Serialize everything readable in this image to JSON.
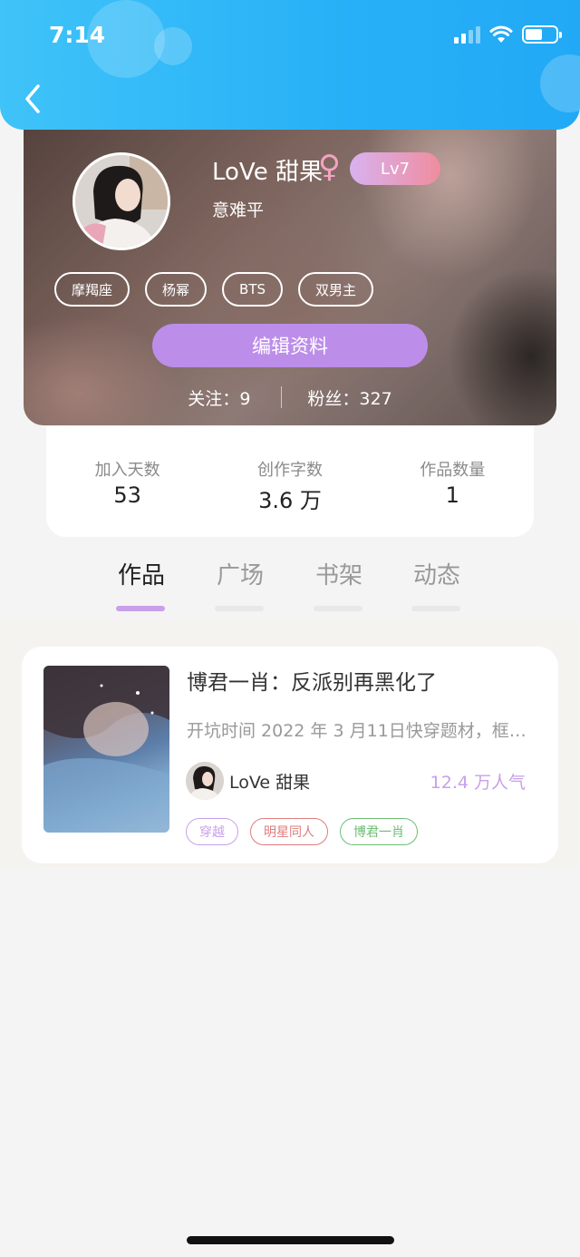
{
  "status_bar": {
    "time": "7:14"
  },
  "profile": {
    "username": "LoVe 甜果",
    "gender_icon": "female-icon",
    "level": "Lv7",
    "signature": "意难平",
    "tags": [
      "摩羯座",
      "杨幂",
      "BTS",
      "双男主"
    ],
    "edit_label": "编辑资料",
    "following_label": "关注：",
    "following_count": "9",
    "fans_label": "粉丝：",
    "fans_count": "327"
  },
  "stats": [
    {
      "label": "加入天数",
      "value": "53"
    },
    {
      "label": "创作字数",
      "value": "3.6 万"
    },
    {
      "label": "作品数量",
      "value": "1"
    }
  ],
  "tabs": [
    {
      "label": "作品",
      "active": true
    },
    {
      "label": "广场",
      "active": false
    },
    {
      "label": "书架",
      "active": false
    },
    {
      "label": "动态",
      "active": false
    }
  ],
  "work": {
    "title": "博君一肖：反派别再黑化了",
    "description": "开坑时间 2022 年 3 月11日快穿题材，框…",
    "author": "LoVe 甜果",
    "popularity": "12.4 万人气",
    "tags": [
      {
        "label": "穿越",
        "color": "#c8a0ea"
      },
      {
        "label": "明星同人",
        "color": "#e07b7b"
      },
      {
        "label": "博君一肖",
        "color": "#6cbf74"
      }
    ]
  },
  "colors": {
    "header": "#27b0f7",
    "accent": "#bc8eea"
  }
}
